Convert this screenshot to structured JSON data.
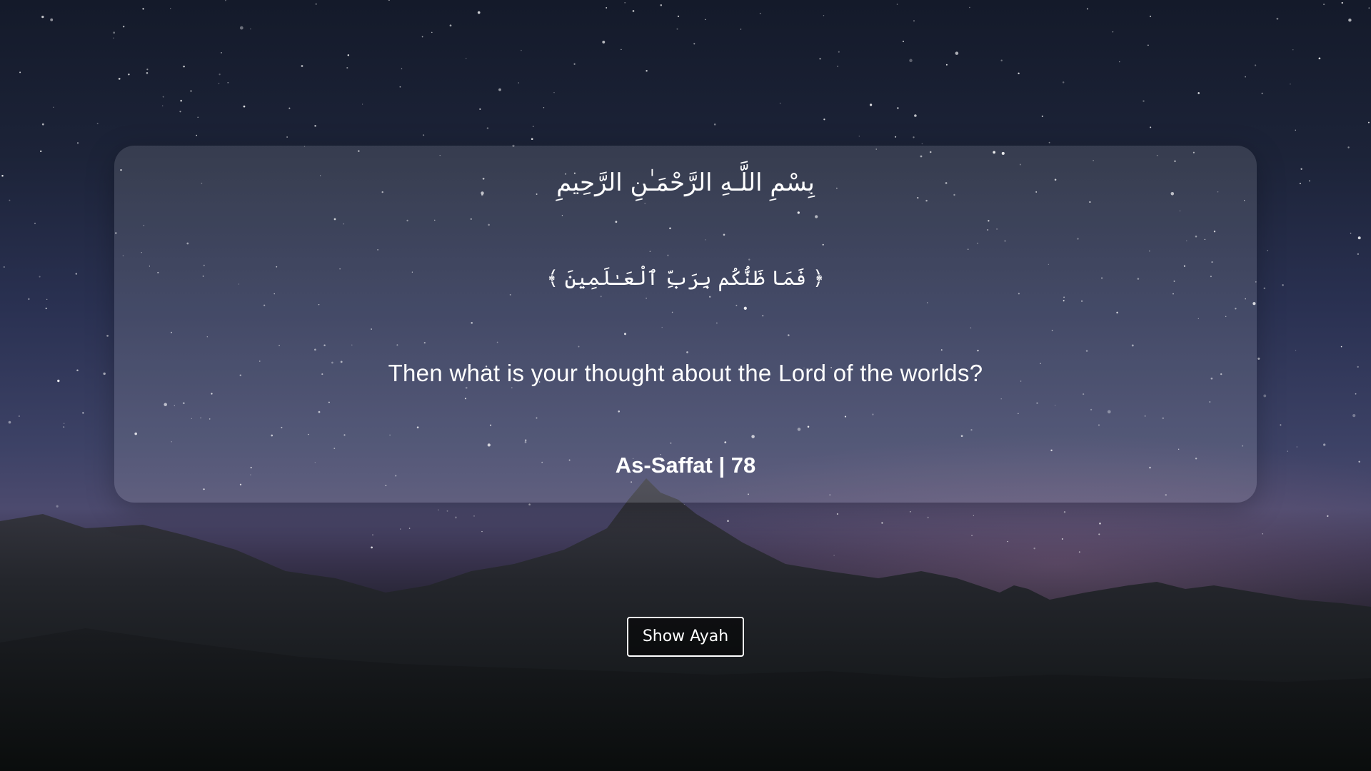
{
  "content": {
    "bismillah": "بِسْمِ اللَّـهِ الرَّحْمَـٰنِ الرَّحِيمِ",
    "ayah_arabic": "﴿ فَمَا ظَنُّكُم بِرَبِّ ٱلْعَـٰلَمِينَ ﴾",
    "translation": "Then what is your thought about the Lord of the worlds?",
    "reference": "As-Saffat | 78"
  },
  "button": {
    "label": "Show Ayah"
  },
  "colors": {
    "text": "#ffffff",
    "card": "rgba(255,255,255,0.12)",
    "button_border": "#ffffff",
    "button_bg": "#0e1212"
  }
}
